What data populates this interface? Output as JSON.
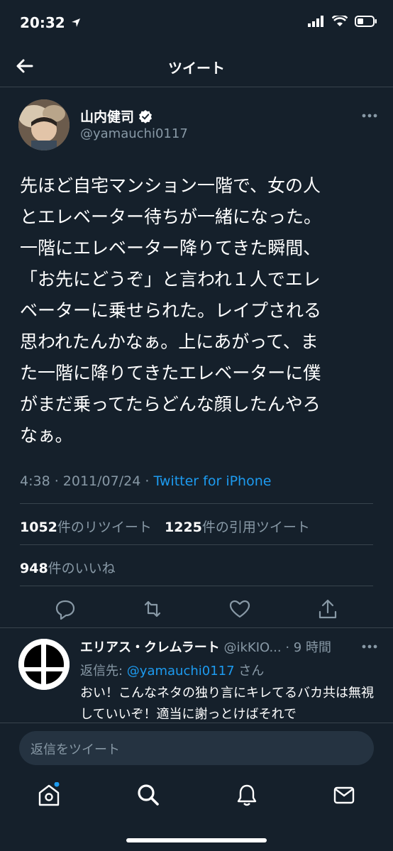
{
  "status_bar": {
    "time": "20:32"
  },
  "header": {
    "title": "ツイート"
  },
  "tweet": {
    "author_name": "山内健司",
    "handle": "@yamauchi0117",
    "text": "先ほど自宅マンション一階で、女の人\nとエレベーター待ちが一緒になった。\n一階にエレベーター降りてきた瞬間、\n「お先にどうぞ」と言われ１人でエレ\nベーターに乗せられた。レイプされる\n思われたんかなぁ。上にあがって、ま\nた一階に降りてきたエレベーターに僕\nがまだ乗ってたらどんな顔したんやろ\nなぁ。",
    "time": "4:38",
    "separator": " · ",
    "date": "2011/07/24",
    "source": "Twitter for iPhone",
    "retweets": {
      "count": "1052",
      "label": "件のリツイート"
    },
    "quotes": {
      "count": "1225",
      "label": "件の引用ツイート"
    },
    "likes": {
      "count": "948",
      "label": "件のいいね"
    }
  },
  "reply": {
    "name": "エリアス・クレムラート",
    "handle_time": " @ikKIO... · 9 時間",
    "to_prefix": "返信先: ",
    "to_handle": "@yamauchi0117",
    "to_suffix": " さん",
    "text": "おい！こんなネタの独り言にキレてるバカ共は無視していいぞ！適当に謝っとけばそれで"
  },
  "compose": {
    "placeholder": "返信をツイート"
  },
  "colors": {
    "background": "#15202b",
    "accent": "#1d9bf0",
    "muted": "#8899a6",
    "divider": "#38444d"
  }
}
